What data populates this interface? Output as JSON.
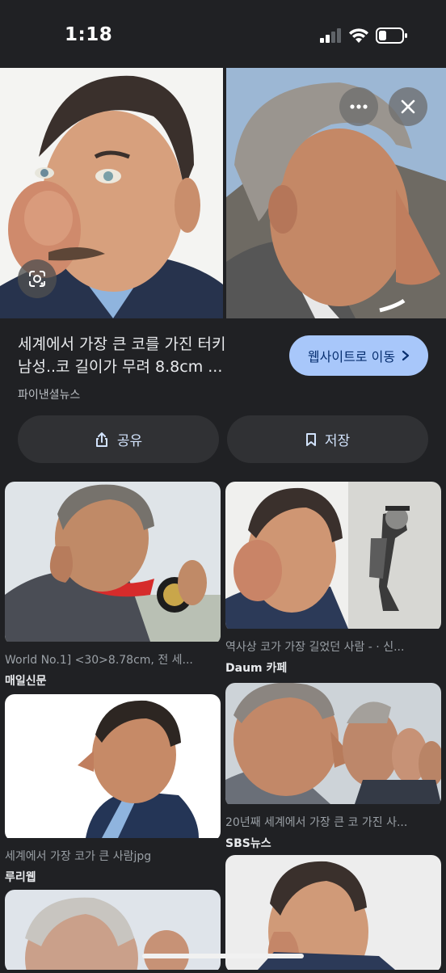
{
  "status": {
    "time": "1:18"
  },
  "hero": {
    "more_icon": "more-horizontal-icon",
    "close_icon": "close-icon",
    "lens_icon": "google-lens-icon"
  },
  "result": {
    "title_line1": "세계에서 가장 큰 코를 가진 터키",
    "title_line2": "남성..코 길이가 무려 8.8cm ...",
    "source": "파이낸셜뉴스",
    "visit_label": "웹사이트로 이동"
  },
  "actions": {
    "share_label": "공유",
    "save_label": "저장"
  },
  "grid": [
    {
      "caption": "World No.1] <30>8.78cm, 전 세...",
      "source": "매일신문"
    },
    {
      "caption": "역사상 코가 가장 길었던 사람 - · 신...",
      "source": "Daum 카페"
    },
    {
      "caption": "세계에서 가장 코가 큰 사람jpg",
      "source": "루리웹"
    },
    {
      "caption": "20년째 세계에서 가장 큰 코 가진 사...",
      "source": "SBS뉴스"
    }
  ],
  "colors": {
    "background": "#202124",
    "accent": "#a8c7fa",
    "button": "#303134"
  }
}
